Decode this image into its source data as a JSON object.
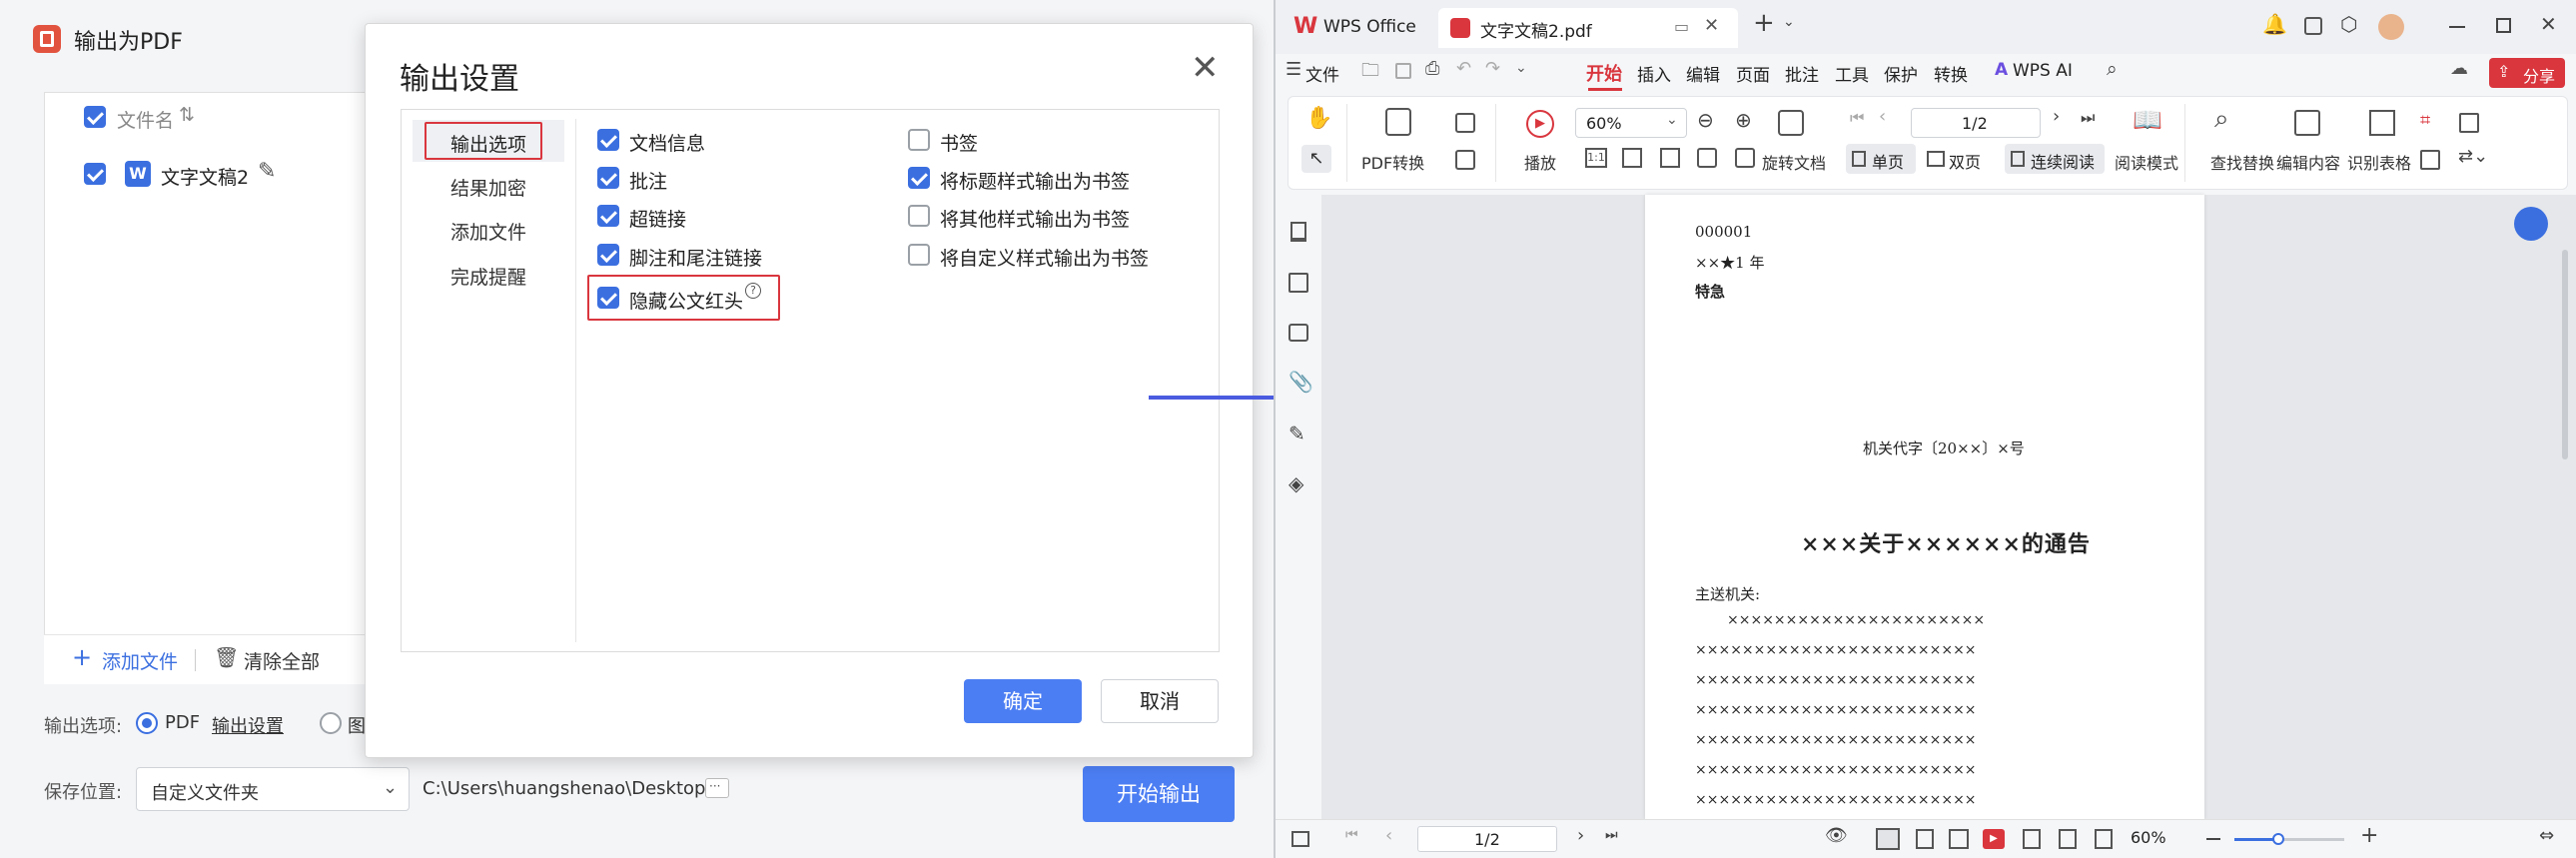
{
  "left": {
    "window_title": "输出为PDF",
    "list_header": "文件名",
    "file_name": "文字文稿2",
    "add_file": "添加文件",
    "clear_all": "清除全部",
    "output_option_label": "输出选项:",
    "pdf_option": "PDF",
    "output_settings_link": "输出设置",
    "image_option": "图",
    "save_location_label": "保存位置:",
    "save_location_value": "自定义文件夹",
    "save_path": "C:\\Users\\huangshenao\\Desktop\\",
    "more": "···",
    "start_button": "开始输出"
  },
  "dialog": {
    "title": "输出设置",
    "nav": [
      "输出选项",
      "结果加密",
      "添加文件",
      "完成提醒"
    ],
    "options_left": [
      {
        "label": "文档信息",
        "checked": true
      },
      {
        "label": "批注",
        "checked": true
      },
      {
        "label": "超链接",
        "checked": true
      },
      {
        "label": "脚注和尾注链接",
        "checked": true
      },
      {
        "label": "隐藏公文红头",
        "checked": true
      }
    ],
    "options_right": [
      {
        "label": "书签",
        "checked": false
      },
      {
        "label": "将标题样式输出为书签",
        "checked": true
      },
      {
        "label": "将其他样式输出为书签",
        "checked": false
      },
      {
        "label": "将自定义样式输出为书签",
        "checked": false
      }
    ],
    "ok": "确定",
    "cancel": "取消",
    "help_glyph": "?"
  },
  "wps": {
    "tab_home": "WPS Office",
    "tab_doc": "文字文稿2.pdf",
    "menu": [
      "文件",
      "开始",
      "插入",
      "编辑",
      "页面",
      "批注",
      "工具",
      "保护",
      "转换",
      "WPS AI"
    ],
    "share": "分享",
    "toolbar": {
      "pdf_convert": "PDF转换",
      "play": "播放",
      "zoom": "60%",
      "page": "1/2",
      "rotate": "旋转文档",
      "single": "单页",
      "double": "双页",
      "continuous": "连续阅读",
      "read_mode": "阅读模式",
      "find_replace": "查找替换",
      "edit_content": "编辑内容",
      "recognize_table": "识别表格"
    },
    "status": {
      "page": "1/2",
      "zoom": "60%"
    },
    "doc": {
      "code": "000001",
      "year": "××★1 年",
      "urgency": "特急",
      "doc_number": "机关代字〔20××〕×号",
      "title": "×××关于××××××的通告",
      "recipient": "主送机关:",
      "body_first": "××××××××××××××××××××××",
      "body": [
        "××××××××××××××××××××××××",
        "××××××××××××××××××××××××",
        "××××××××××××××××××××××××",
        "××××××××××××××××××××××××",
        "××××××××××××××××××××××××",
        "××××××××××××××××××××××××"
      ]
    }
  },
  "colors": {
    "accent": "#3b6fe0",
    "highlight": "#d9363e",
    "arrow": "#4a5be0",
    "wps_red": "#d9363e"
  }
}
